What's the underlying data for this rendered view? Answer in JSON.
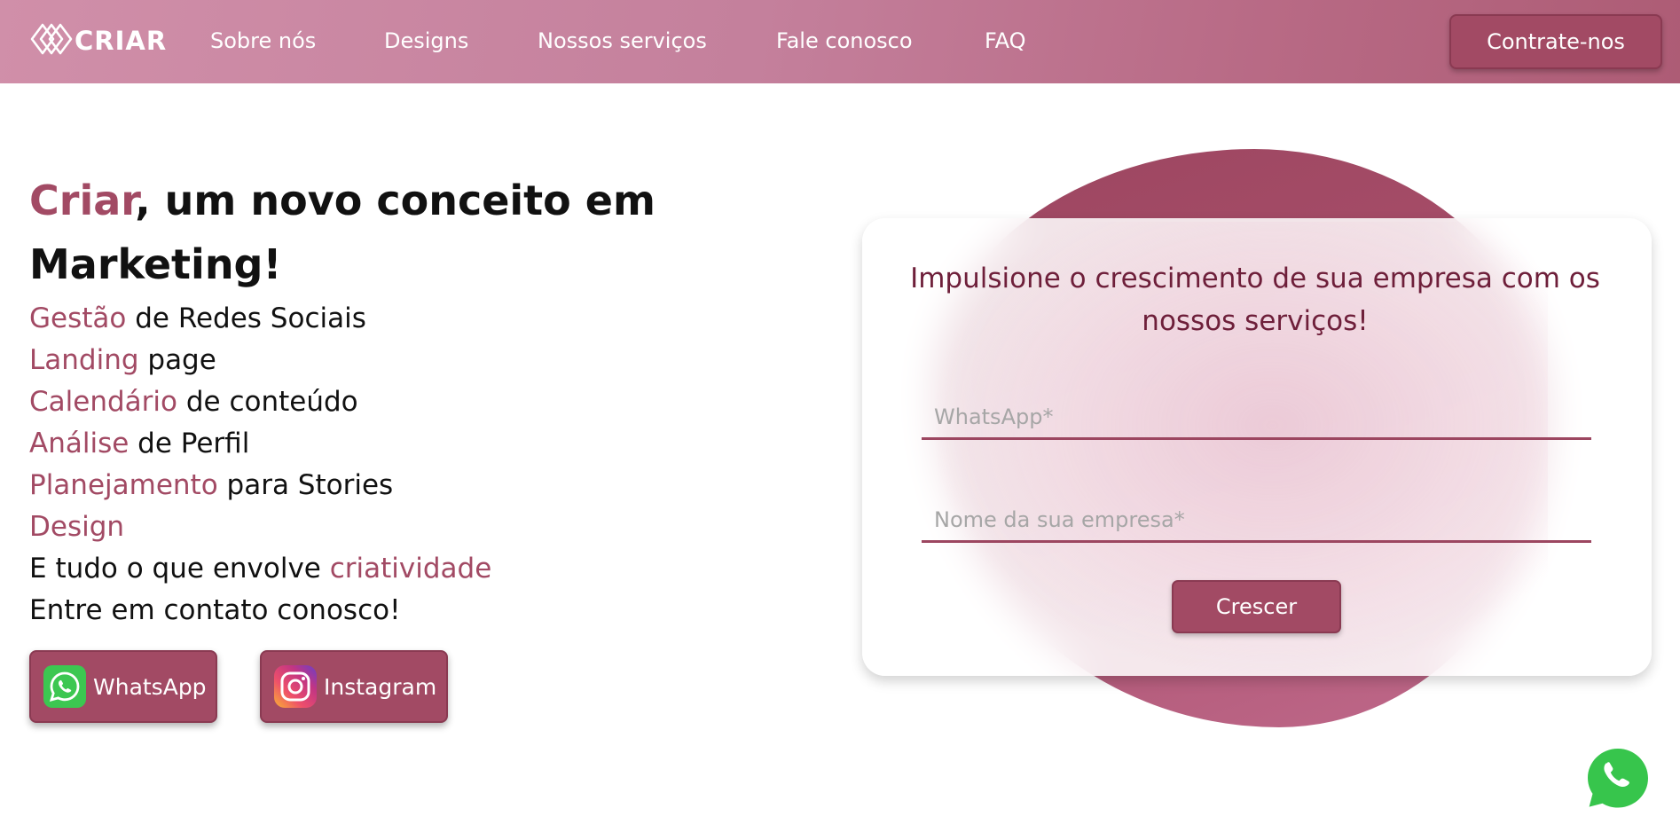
{
  "header": {
    "logo_text": "CRIAR",
    "nav": [
      "Sobre nós",
      "Designs",
      "Nossos serviços",
      "Fale conosco",
      "FAQ"
    ],
    "cta_label": "Contrate-nos"
  },
  "hero": {
    "headline_accent": "Criar",
    "headline_rest": ", um novo conceito em Marketing!",
    "services": [
      {
        "accent": "Gestão",
        "text": " de Redes Sociais"
      },
      {
        "accent": "Landing",
        "text": " page"
      },
      {
        "accent": "Calendário",
        "text": " de conteúdo"
      },
      {
        "accent": "Análise",
        "text": " de Perfil"
      },
      {
        "accent": "Planejamento",
        "text": " para Stories"
      },
      {
        "accent": "Design",
        "text": ""
      }
    ],
    "line_creativity_prefix": "E tudo o que envolve ",
    "line_creativity_accent": "criatividade",
    "contact_line": "Entre em contato conosco!",
    "whatsapp_label": "WhatsApp",
    "instagram_label": "Instagram"
  },
  "form": {
    "title": "Impulsione o crescimento de sua empresa com os nossos serviços!",
    "whatsapp_placeholder": "WhatsApp*",
    "company_placeholder": "Nome da sua empresa*",
    "submit_label": "Crescer"
  },
  "colors": {
    "accent": "#a24a64",
    "header_start": "#d08fa9",
    "header_end": "#ad5c75",
    "form_title": "#6e1f3a"
  },
  "icons": [
    "logo-diamond-icon",
    "whatsapp-icon",
    "instagram-icon",
    "floating-whatsapp-icon"
  ]
}
